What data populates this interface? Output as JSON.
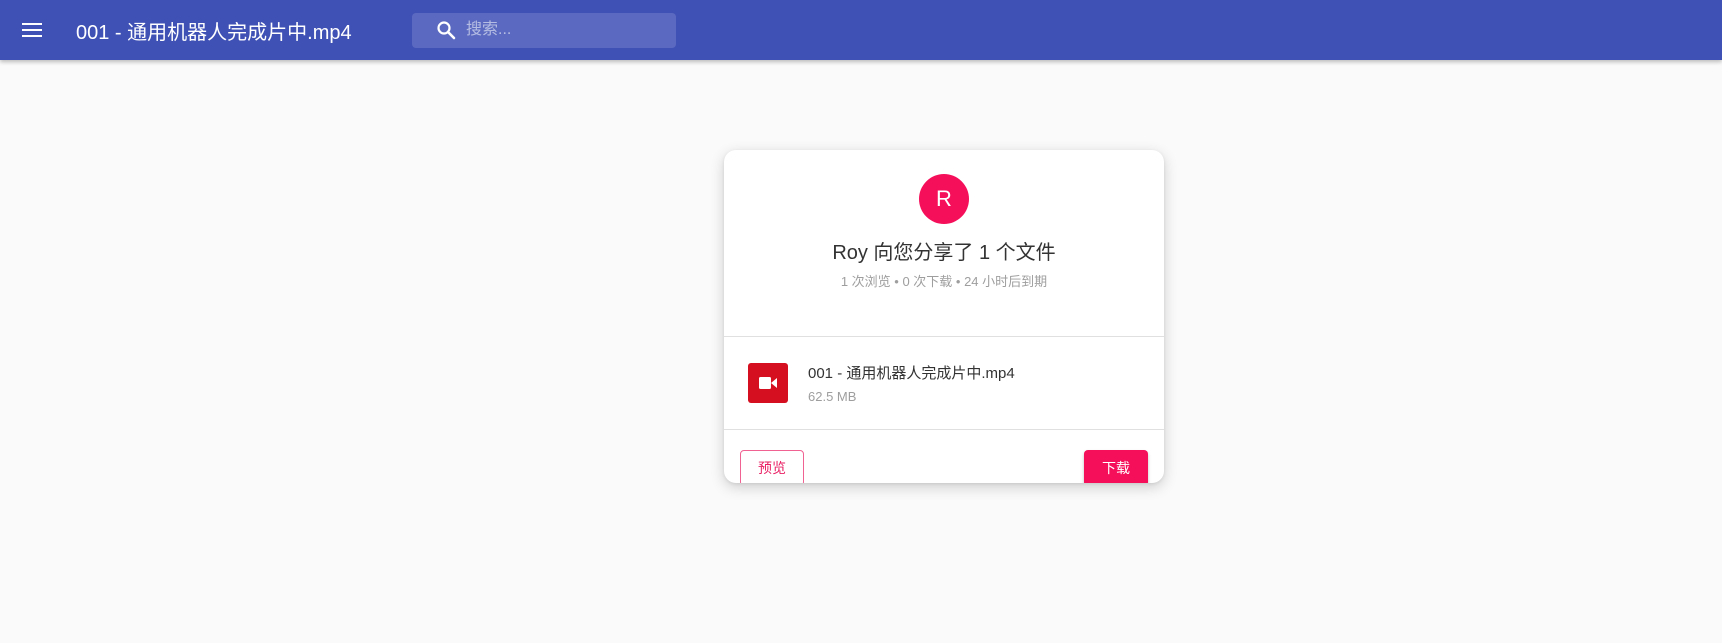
{
  "appbar": {
    "title": "001 - 通用机器人完成片中.mp4",
    "menu_icon": "menu-icon",
    "search": {
      "placeholder": "搜索...",
      "value": "",
      "icon": "search-icon"
    },
    "color": "#3f51b5"
  },
  "share": {
    "avatar_letter": "R",
    "avatar_color": "#f50f5b",
    "title": "Roy 向您分享了 1 个文件",
    "meta": "1 次浏览 • 0 次下载 • 24 小时后到期"
  },
  "file": {
    "icon": "video-camera-icon",
    "icon_color": "#d50f1f",
    "name": "001 - 通用机器人完成片中.mp4",
    "size": "62.5 MB"
  },
  "actions": {
    "preview_label": "预览",
    "download_label": "下载",
    "accent": "#f50f5b"
  }
}
